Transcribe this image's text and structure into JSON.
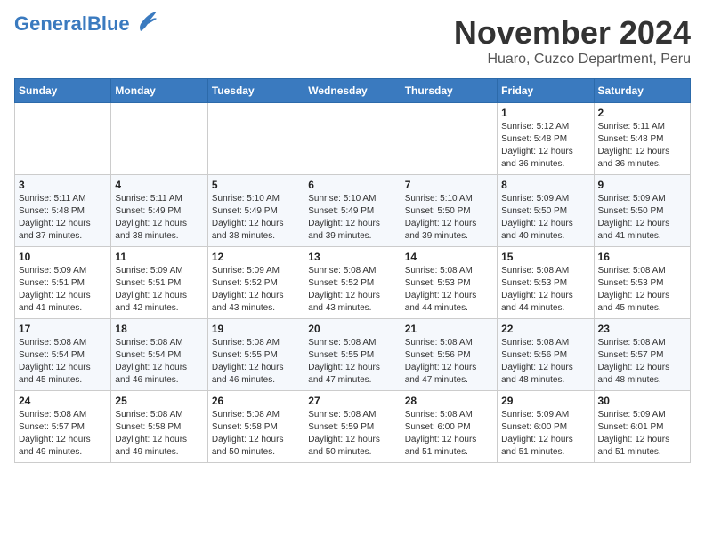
{
  "header": {
    "logo_general": "General",
    "logo_blue": "Blue",
    "month_title": "November 2024",
    "location": "Huaro, Cuzco Department, Peru"
  },
  "weekdays": [
    "Sunday",
    "Monday",
    "Tuesday",
    "Wednesday",
    "Thursday",
    "Friday",
    "Saturday"
  ],
  "weeks": [
    [
      {
        "day": "",
        "info": ""
      },
      {
        "day": "",
        "info": ""
      },
      {
        "day": "",
        "info": ""
      },
      {
        "day": "",
        "info": ""
      },
      {
        "day": "",
        "info": ""
      },
      {
        "day": "1",
        "info": "Sunrise: 5:12 AM\nSunset: 5:48 PM\nDaylight: 12 hours and 36 minutes."
      },
      {
        "day": "2",
        "info": "Sunrise: 5:11 AM\nSunset: 5:48 PM\nDaylight: 12 hours and 36 minutes."
      }
    ],
    [
      {
        "day": "3",
        "info": "Sunrise: 5:11 AM\nSunset: 5:48 PM\nDaylight: 12 hours and 37 minutes."
      },
      {
        "day": "4",
        "info": "Sunrise: 5:11 AM\nSunset: 5:49 PM\nDaylight: 12 hours and 38 minutes."
      },
      {
        "day": "5",
        "info": "Sunrise: 5:10 AM\nSunset: 5:49 PM\nDaylight: 12 hours and 38 minutes."
      },
      {
        "day": "6",
        "info": "Sunrise: 5:10 AM\nSunset: 5:49 PM\nDaylight: 12 hours and 39 minutes."
      },
      {
        "day": "7",
        "info": "Sunrise: 5:10 AM\nSunset: 5:50 PM\nDaylight: 12 hours and 39 minutes."
      },
      {
        "day": "8",
        "info": "Sunrise: 5:09 AM\nSunset: 5:50 PM\nDaylight: 12 hours and 40 minutes."
      },
      {
        "day": "9",
        "info": "Sunrise: 5:09 AM\nSunset: 5:50 PM\nDaylight: 12 hours and 41 minutes."
      }
    ],
    [
      {
        "day": "10",
        "info": "Sunrise: 5:09 AM\nSunset: 5:51 PM\nDaylight: 12 hours and 41 minutes."
      },
      {
        "day": "11",
        "info": "Sunrise: 5:09 AM\nSunset: 5:51 PM\nDaylight: 12 hours and 42 minutes."
      },
      {
        "day": "12",
        "info": "Sunrise: 5:09 AM\nSunset: 5:52 PM\nDaylight: 12 hours and 43 minutes."
      },
      {
        "day": "13",
        "info": "Sunrise: 5:08 AM\nSunset: 5:52 PM\nDaylight: 12 hours and 43 minutes."
      },
      {
        "day": "14",
        "info": "Sunrise: 5:08 AM\nSunset: 5:53 PM\nDaylight: 12 hours and 44 minutes."
      },
      {
        "day": "15",
        "info": "Sunrise: 5:08 AM\nSunset: 5:53 PM\nDaylight: 12 hours and 44 minutes."
      },
      {
        "day": "16",
        "info": "Sunrise: 5:08 AM\nSunset: 5:53 PM\nDaylight: 12 hours and 45 minutes."
      }
    ],
    [
      {
        "day": "17",
        "info": "Sunrise: 5:08 AM\nSunset: 5:54 PM\nDaylight: 12 hours and 45 minutes."
      },
      {
        "day": "18",
        "info": "Sunrise: 5:08 AM\nSunset: 5:54 PM\nDaylight: 12 hours and 46 minutes."
      },
      {
        "day": "19",
        "info": "Sunrise: 5:08 AM\nSunset: 5:55 PM\nDaylight: 12 hours and 46 minutes."
      },
      {
        "day": "20",
        "info": "Sunrise: 5:08 AM\nSunset: 5:55 PM\nDaylight: 12 hours and 47 minutes."
      },
      {
        "day": "21",
        "info": "Sunrise: 5:08 AM\nSunset: 5:56 PM\nDaylight: 12 hours and 47 minutes."
      },
      {
        "day": "22",
        "info": "Sunrise: 5:08 AM\nSunset: 5:56 PM\nDaylight: 12 hours and 48 minutes."
      },
      {
        "day": "23",
        "info": "Sunrise: 5:08 AM\nSunset: 5:57 PM\nDaylight: 12 hours and 48 minutes."
      }
    ],
    [
      {
        "day": "24",
        "info": "Sunrise: 5:08 AM\nSunset: 5:57 PM\nDaylight: 12 hours and 49 minutes."
      },
      {
        "day": "25",
        "info": "Sunrise: 5:08 AM\nSunset: 5:58 PM\nDaylight: 12 hours and 49 minutes."
      },
      {
        "day": "26",
        "info": "Sunrise: 5:08 AM\nSunset: 5:58 PM\nDaylight: 12 hours and 50 minutes."
      },
      {
        "day": "27",
        "info": "Sunrise: 5:08 AM\nSunset: 5:59 PM\nDaylight: 12 hours and 50 minutes."
      },
      {
        "day": "28",
        "info": "Sunrise: 5:08 AM\nSunset: 6:00 PM\nDaylight: 12 hours and 51 minutes."
      },
      {
        "day": "29",
        "info": "Sunrise: 5:09 AM\nSunset: 6:00 PM\nDaylight: 12 hours and 51 minutes."
      },
      {
        "day": "30",
        "info": "Sunrise: 5:09 AM\nSunset: 6:01 PM\nDaylight: 12 hours and 51 minutes."
      }
    ]
  ]
}
